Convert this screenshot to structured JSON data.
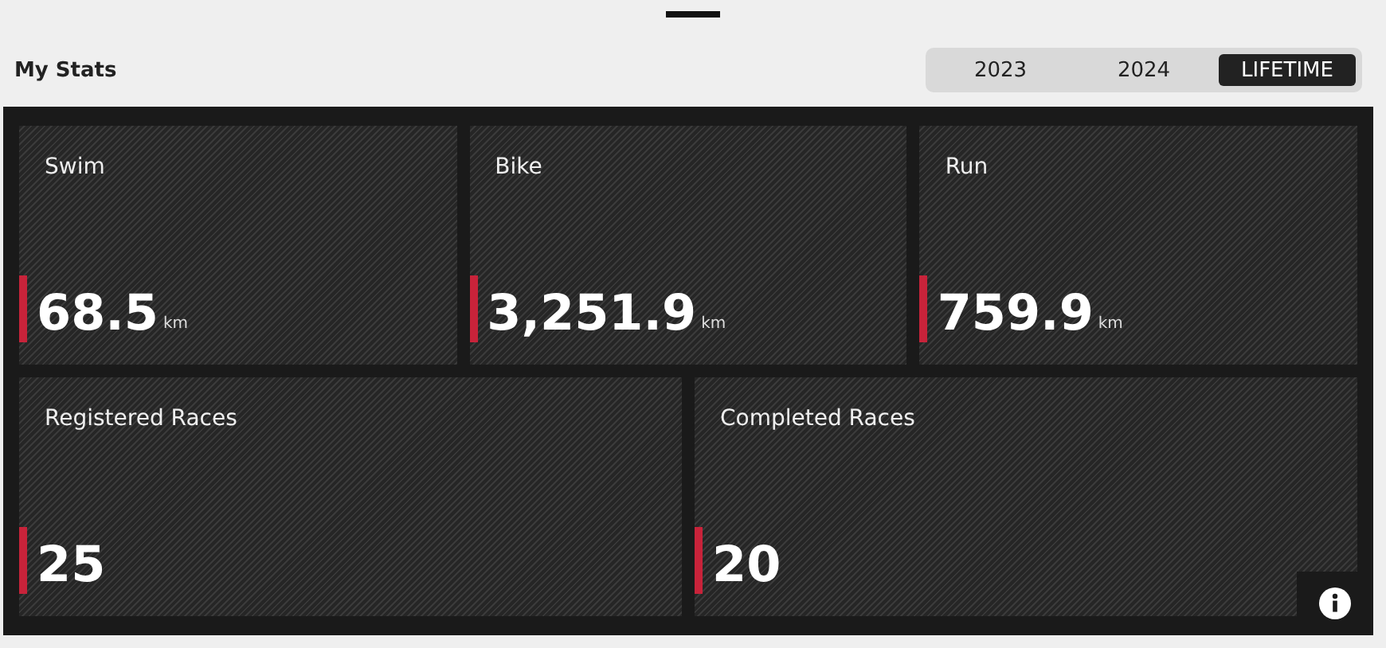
{
  "title": "My Stats",
  "periods": [
    {
      "label": "2023",
      "selected": false
    },
    {
      "label": "2024",
      "selected": false
    },
    {
      "label": "LIFETIME",
      "selected": true
    }
  ],
  "top_stats": [
    {
      "label": "Swim",
      "value": "68.5",
      "unit": "km"
    },
    {
      "label": "Bike",
      "value": "3,251.9",
      "unit": "km"
    },
    {
      "label": "Run",
      "value": "759.9",
      "unit": "km"
    }
  ],
  "bottom_stats": [
    {
      "label": "Registered Races",
      "value": "25"
    },
    {
      "label": "Completed Races",
      "value": "20"
    }
  ]
}
